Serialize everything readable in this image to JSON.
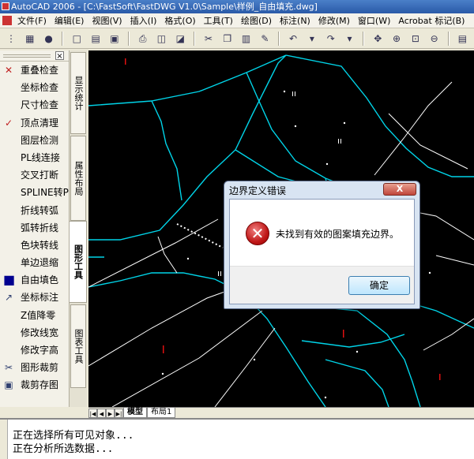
{
  "window": {
    "title": "AutoCAD 2006 - [C:\\FastSoft\\FastDWG V1.0\\Sample\\样例_自由填充.dwg]"
  },
  "menu": [
    "文件(F)",
    "编辑(E)",
    "视图(V)",
    "插入(I)",
    "格式(O)",
    "工具(T)",
    "绘图(D)",
    "标注(N)",
    "修改(M)",
    "窗口(W)",
    "Acrobat 标记(B)"
  ],
  "palette": {
    "items": [
      {
        "label": "重叠检查",
        "icon": "✕",
        "icon_name": "overlap-check-icon"
      },
      {
        "label": "坐标检查",
        "icon": "",
        "icon_name": ""
      },
      {
        "label": "尺寸检查",
        "icon": "",
        "icon_name": ""
      },
      {
        "label": "顶点清理",
        "icon": "✓",
        "icon_name": "vertex-clean-icon"
      },
      {
        "label": "图层检测",
        "icon": "",
        "icon_name": ""
      },
      {
        "label": "PL线连接",
        "icon": "",
        "icon_name": ""
      },
      {
        "label": "交叉打断",
        "icon": "",
        "icon_name": ""
      },
      {
        "label": "SPLINE转PL",
        "icon": "",
        "icon_name": ""
      },
      {
        "label": "折线转弧",
        "icon": "",
        "icon_name": ""
      },
      {
        "label": "弧转折线",
        "icon": "",
        "icon_name": ""
      },
      {
        "label": "色块转线",
        "icon": "",
        "icon_name": ""
      },
      {
        "label": "单边退缩",
        "icon": "",
        "icon_name": ""
      },
      {
        "label": "自由填色",
        "icon": "■",
        "icon_name": "fill-color-icon"
      },
      {
        "label": "坐标标注",
        "icon": "↗",
        "icon_name": "coordinate-label-icon"
      },
      {
        "label": "Z值降零",
        "icon": "",
        "icon_name": ""
      },
      {
        "label": "修改线宽",
        "icon": "",
        "icon_name": ""
      },
      {
        "label": "修改字高",
        "icon": "",
        "icon_name": ""
      },
      {
        "label": "图形裁剪",
        "icon": "✂",
        "icon_name": "clip-icon"
      },
      {
        "label": "裁剪存图",
        "icon": "▣",
        "icon_name": "clip-save-icon"
      }
    ]
  },
  "vtabs": [
    {
      "label": "显示统计",
      "active": false
    },
    {
      "label": "属性布局",
      "active": false
    },
    {
      "label": "图形工具",
      "active": true
    },
    {
      "label": "图表工具",
      "active": false
    }
  ],
  "layout_tabs": [
    {
      "label": "模型",
      "selected": true
    },
    {
      "label": "布局1",
      "selected": false
    }
  ],
  "command_lines": [
    "正在选择所有可见对象...",
    "正在分析所选数据..."
  ],
  "dialog": {
    "title": "边界定义错误",
    "close_label": "X",
    "message": "未找到有效的图案填充边界。",
    "ok_label": "确定"
  },
  "colors": {
    "cyan": "#00d4e8",
    "red": "#e01010",
    "background": "#000000"
  }
}
